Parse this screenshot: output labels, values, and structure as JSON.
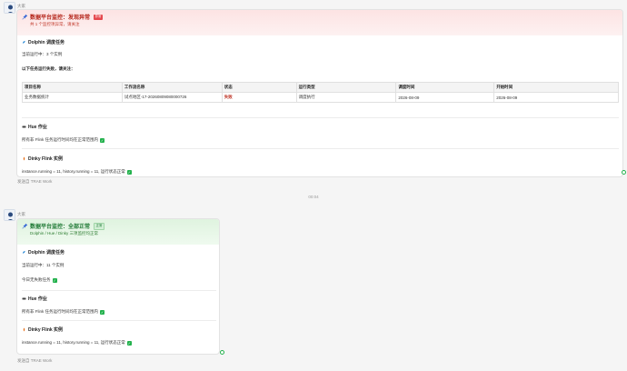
{
  "messages": [
    {
      "sender": "大家",
      "title": "数据平台监控：发现异常",
      "tag": "异常",
      "subtitle": "共 1 个监控项异常，请关注",
      "dolphin": {
        "title": "Dolphin 调度任务",
        "running": "当前运行中：3 个实例",
        "fail_note": "以下任务运行失败，请关注：",
        "table": {
          "headers": [
            "项目名称",
            "工作流名称",
            "状态",
            "运行类型",
            "调度时间",
            "开始时间"
          ],
          "rows": [
            [
              "业务数据统计",
              "试点地区-17-20260809080000726",
              "失败",
              "调度执行",
              "2026-08-09",
              "2026-08-09"
            ]
          ]
        }
      },
      "hue": {
        "title": "Hue 作业",
        "text": "所有非 Flink 任务运行时间均在正常范围内"
      },
      "dinky": {
        "title": "Dinky Flink 实例",
        "text": "instance.running = 11, history.running = 11, 运行状态正常"
      },
      "from": "发送自 TRAE Work"
    },
    {
      "sender": "大家",
      "title": "数据平台监控：全部正常",
      "tag": "正常",
      "subtitle": "Dolphin / Hue / Dinky 三项监控均正常",
      "dolphin": {
        "title": "Dolphin 调度任务",
        "running": "当前运行中：11 个实例",
        "no_fail": "今日无失败任务"
      },
      "hue": {
        "title": "Hue 作业",
        "text": "所有非 Flink 任务运行时间均在正常范围内"
      },
      "dinky": {
        "title": "Dinky Flink 实例",
        "text": "instance.running = 11, history.running = 11, 运行状态正常"
      },
      "from": "发送自 TRAE Work"
    }
  ],
  "timestamp": "00:04",
  "check_glyph": "✓",
  "icons": {
    "pin": "pushpin-icon",
    "dolphin": "dolphin-icon",
    "hue": "hue-icon",
    "dinky": "dinky-icon",
    "check": "check-icon"
  },
  "colors": {
    "alert_red": "#b42318",
    "ok_green": "#1f7a35",
    "check_green": "#22b14c"
  }
}
